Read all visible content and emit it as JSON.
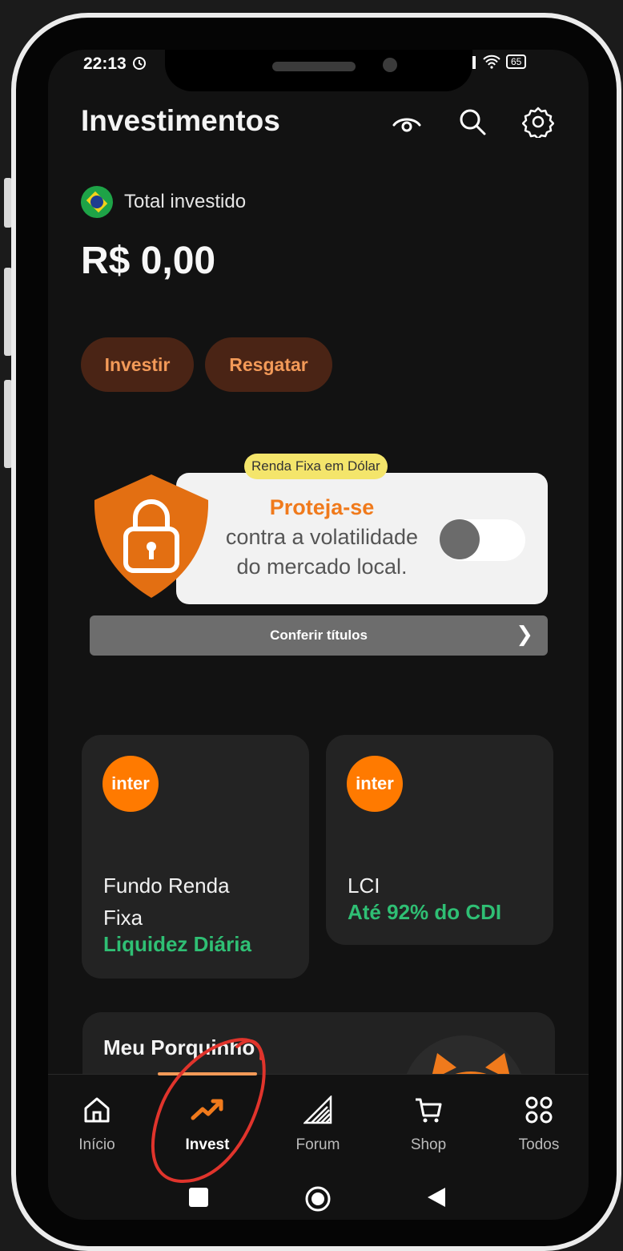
{
  "status_bar": {
    "time": "22:13",
    "battery": "65"
  },
  "header": {
    "title": "Investimentos"
  },
  "balance": {
    "label": "Total investido",
    "amount": "R$ 0,00"
  },
  "actions": {
    "invest": "Investir",
    "redeem": "Resgatar"
  },
  "promo": {
    "tag": "Renda Fixa em Dólar",
    "headline": "Proteja-se",
    "line1": "contra a volatilidade",
    "line2": "do mercado local.",
    "cta": "Conferir títulos"
  },
  "products": [
    {
      "logo": "inter",
      "title_line1": "Fundo Renda",
      "title_line2": "Fixa",
      "subtitle": "Liquidez Diária"
    },
    {
      "logo": "inter",
      "title_line1": "LCI",
      "subtitle": "Até 92% do CDI"
    }
  ],
  "piggy": {
    "title": "Meu Porquinho"
  },
  "nav": [
    {
      "label": "Início",
      "icon": "home-icon"
    },
    {
      "label": "Invest",
      "icon": "trending-up-icon",
      "active": true
    },
    {
      "label": "Forum",
      "icon": "forum-icon"
    },
    {
      "label": "Shop",
      "icon": "cart-icon"
    },
    {
      "label": "Todos",
      "icon": "grid-icon"
    }
  ],
  "colors": {
    "accent": "#f39a58",
    "brand_orange": "#ff7a00",
    "positive": "#2fbf74",
    "annotation": "#e0342c"
  }
}
